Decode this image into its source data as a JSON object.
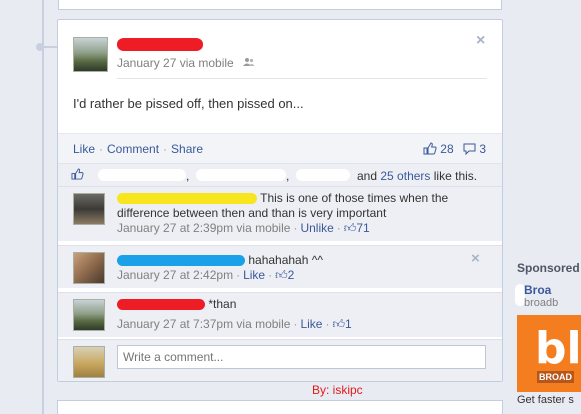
{
  "post": {
    "timestamp": "January 27 via mobile",
    "status_text": "I'd rather be pissed off, then pissed on...",
    "actions": {
      "like": "Like",
      "comment": "Comment",
      "share": "Share"
    },
    "like_count": "28",
    "comment_count": "3"
  },
  "likes_summary": {
    "comma1": ",",
    "comma2": ",",
    "and_text": "and",
    "others_link": "25 others",
    "suffix": "like this."
  },
  "comments": [
    {
      "text": "This is one of those times when the difference between then and than is very important",
      "time": "January 27 at 2:39pm via mobile",
      "action": "Unlike",
      "likes": "71",
      "redact_color": "#f7e51e"
    },
    {
      "text": "hahahahah ^^",
      "time": "January 27 at 2:42pm",
      "action": "Like",
      "likes": "2",
      "redact_color": "#1ba1e8"
    },
    {
      "text": "*than",
      "time": "January 27 at 7:37pm via mobile",
      "action": "Like",
      "likes": "1",
      "redact_color": "#ee1c24"
    }
  ],
  "write_comment": {
    "placeholder": "Write a comment..."
  },
  "credit": "By: iskipc",
  "sidebar": {
    "sponsored": "Sponsored",
    "ad_title": "Broa",
    "ad_url": "broadb",
    "ad_image_text": "bl",
    "ad_image_sub": "BROAD",
    "ad_text": "Get faster s"
  },
  "colors": {
    "link": "#3b5998",
    "redact_red": "#ee1c24",
    "redact_yellow": "#f7e51e",
    "redact_blue": "#1ba1e8",
    "ad_orange": "#f47d20",
    "credit": "#e21a1a"
  }
}
